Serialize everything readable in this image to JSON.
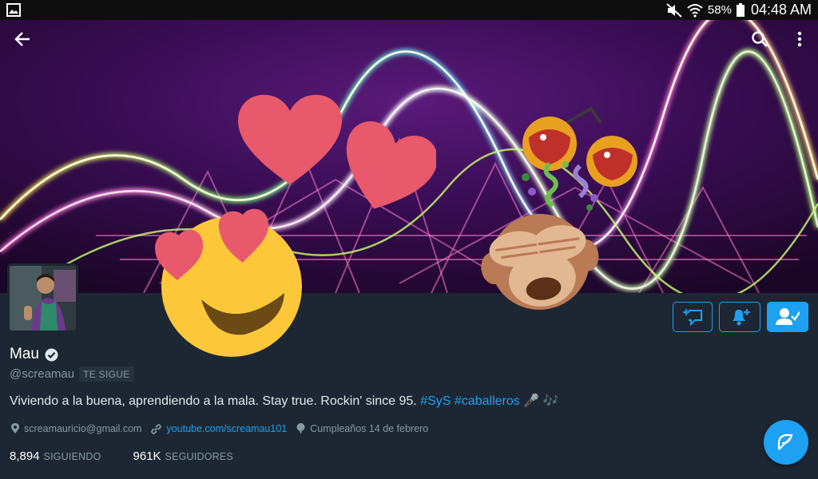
{
  "status_bar": {
    "battery_percent": "58%",
    "time": "04:48 AM",
    "icons": [
      "gallery-icon",
      "mute-icon",
      "wifi-icon",
      "battery-icon"
    ]
  },
  "top_bar": {
    "icons": [
      "back-arrow-icon",
      "search-icon",
      "more-vert-icon"
    ]
  },
  "stickers": [
    "heart-eyes-emoji",
    "heart-emoji",
    "heart-emoji",
    "see-no-evil-monkey-emoji",
    "confetti-emoji",
    "maracas-emoji"
  ],
  "actions": {
    "icons": [
      "add-to-list-icon",
      "notifications-add-icon",
      "following-icon"
    ]
  },
  "profile": {
    "name": "Mau",
    "verified_icon": "verified-badge-icon",
    "handle": "@screamau",
    "follows_you": "TE SIGUE",
    "bio_text": "Viviendo a la buena, aprendiendo a la mala. Stay true. Rockin' since 95.",
    "bio_tag1": "#SyS",
    "bio_tag2": "#caballeros",
    "bio_emoji": "🎤 🎶",
    "location": "screamauricio@gmail.com",
    "website": "youtube.com/screamau101",
    "birthday": "Cumpleaños 14 de febrero"
  },
  "stats": {
    "following_count": "8,894",
    "following_label": "SIGUIENDO",
    "followers_count": "961K",
    "followers_label": "SEGUIDORES"
  },
  "colors": {
    "accent": "#1da1f2",
    "background": "#1c2733",
    "muted_text": "#8899a6"
  }
}
